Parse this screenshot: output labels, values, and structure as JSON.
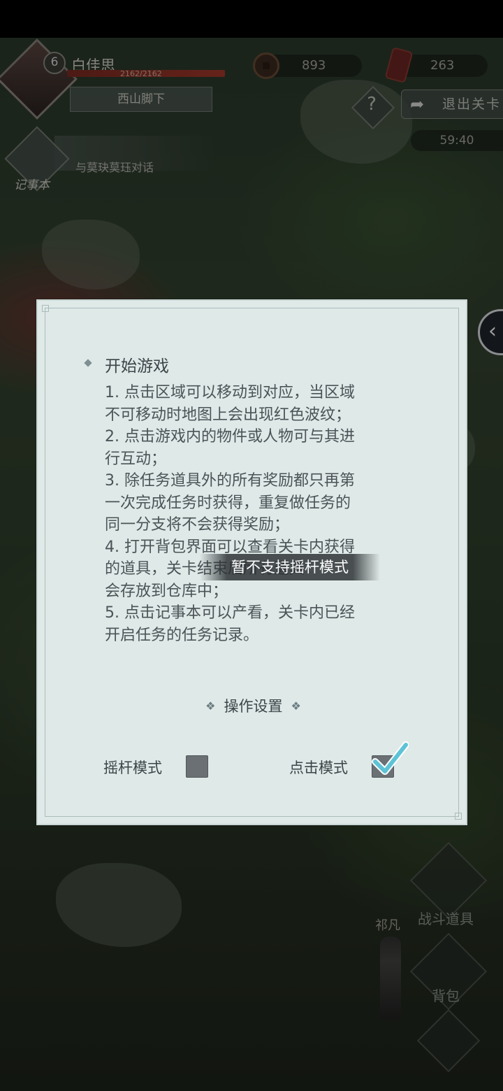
{
  "hud": {
    "level": "6",
    "player_name": "白佳思",
    "hp_text": "2162/2162",
    "hp_fraction": 1.0,
    "location": "西山脚下",
    "coins": "893",
    "tokens": "263",
    "help_symbol": "?",
    "exit_label": "退出关卡",
    "timer": "59:40",
    "notebook_label": "记事本",
    "current_quest": "与莫玦莫珏对话",
    "side_toggle_symbol": "‹"
  },
  "dialog": {
    "section_title": "开始游戏",
    "rules": [
      "1. 点击区域可以移动到对应，当区域",
      "不可移动时地图上会出现红色波纹；",
      "2. 点击游戏内的物件或人物可与其进",
      "行互动；",
      "3. 除任务道具外的所有奖励都只再第",
      "一次完成任务时获得，重复做任务的",
      "同一分支将不会获得奖励；",
      "4. 打开背包界面可以查看关卡内获得",
      "的道具，关卡结束后所有道具",
      "会存放到仓库中；",
      "5. 点击记事本可以产看，关卡内已经",
      "开启任务的任务记录。"
    ],
    "settings_title": "操作设置",
    "settings_bullet": "❖",
    "joystick_label": "摇杆模式",
    "joystick_checked": false,
    "tap_label": "点击模式",
    "tap_checked": true,
    "toast": "暂不支持摇杆模式"
  },
  "tools": {
    "battle_items": "战斗道具",
    "backpack": "背包"
  },
  "npc_name": "祁凡",
  "colors": {
    "dialog_bg": "#dfe9e7",
    "dialog_text": "#4b5357",
    "checkbox_gray": "#6b7074",
    "check_teal": "#5ec3d6"
  }
}
